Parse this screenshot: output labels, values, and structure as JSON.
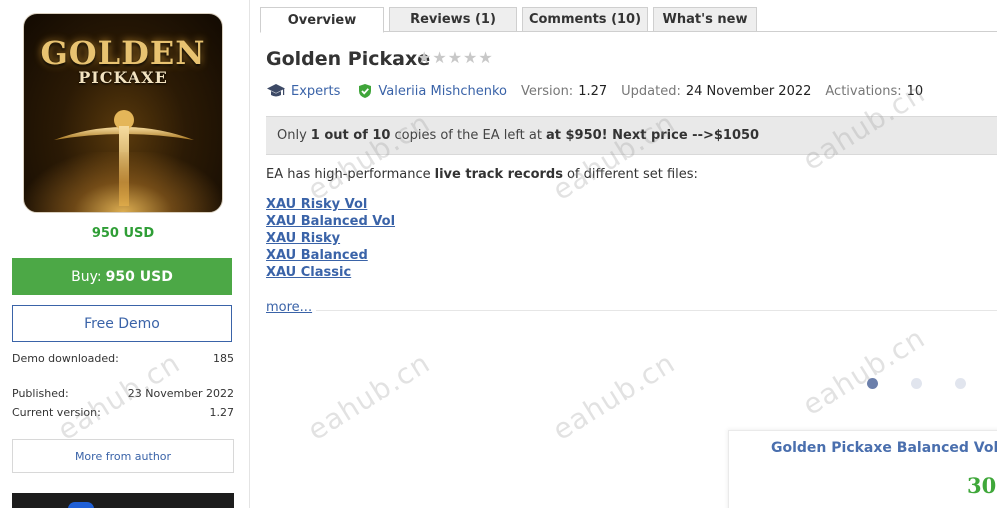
{
  "sidebar": {
    "image": {
      "line1": "GOLDEN",
      "line2": "PICKAXE"
    },
    "price": "950 USD",
    "buy_label": "Buy:",
    "buy_price": "950 USD",
    "demo_label": "Free Demo",
    "demo_downloaded_label": "Demo downloaded:",
    "demo_downloaded_value": "185",
    "published_label": "Published:",
    "published_value": "23 November 2022",
    "current_version_label": "Current version:",
    "current_version_value": "1.27",
    "more_from_author": "More from author"
  },
  "tabs": [
    {
      "label": "Overview"
    },
    {
      "label": "Reviews (1)"
    },
    {
      "label": "Comments (10)"
    },
    {
      "label": "What's new"
    }
  ],
  "product": {
    "title": "Golden Pickaxe",
    "rating": 0,
    "category": "Experts",
    "author": "Valeriia Mishchenko",
    "version_label": "Version:",
    "version": "1.27",
    "updated_label": "Updated:",
    "updated": "24 November 2022",
    "activations_label": "Activations:",
    "activations": "10"
  },
  "notice": {
    "part1": "Only",
    "bold1": "1 out of 10",
    "part2": "copies of the EA left at",
    "bold2": "at $950! Next price -->$1050"
  },
  "description": {
    "part1": "EA has high-performance",
    "bold": "live track records",
    "part2": "of different set files:"
  },
  "links": [
    "XAU Risky Vol",
    "XAU Balanced Vol",
    "XAU Risky",
    "XAU Balanced",
    "XAU Classic"
  ],
  "more_label": "more...",
  "carousel": {
    "active_index": 0,
    "count": 3
  },
  "card": {
    "title": "Golden Pickaxe Balanced Vol",
    "number": "30"
  },
  "watermark": "eahub.cn",
  "colors": {
    "accent_green": "#4ca846",
    "link_blue": "#3a63a8",
    "price_green": "#2f9e36"
  }
}
